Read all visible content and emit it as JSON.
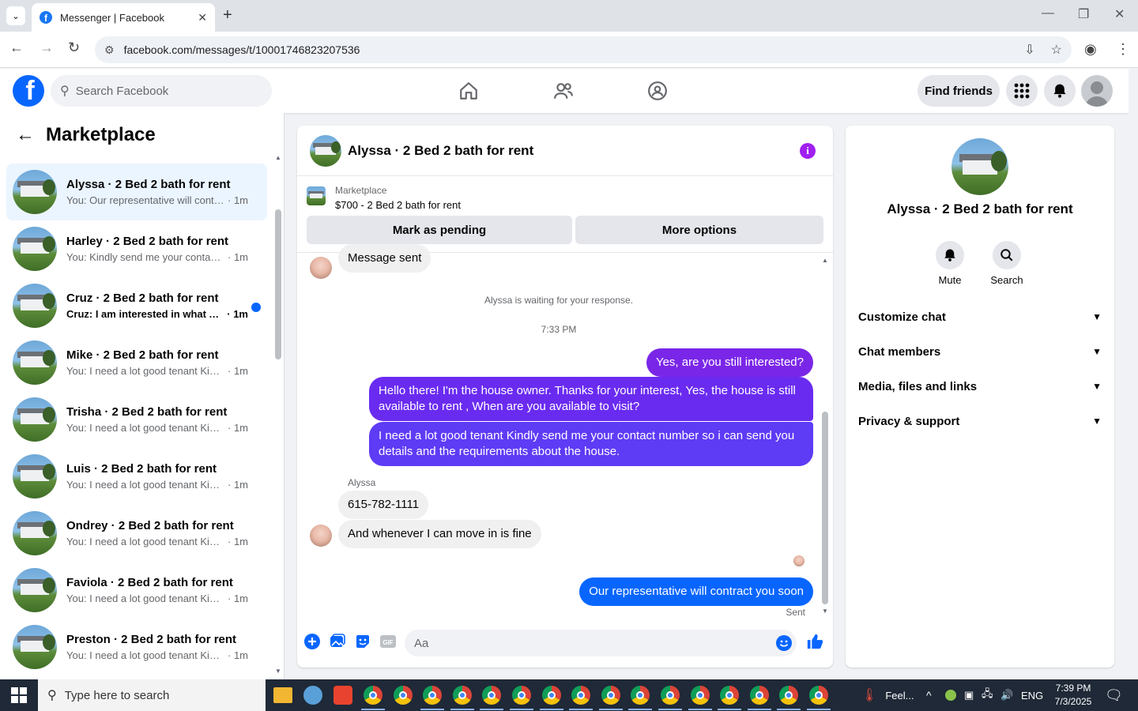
{
  "browser": {
    "tab_title": "Messenger | Facebook",
    "url": "facebook.com/messages/t/10001746823207536"
  },
  "fbnav": {
    "search_placeholder": "Search Facebook",
    "find_friends": "Find friends"
  },
  "sidebar": {
    "title": "Marketplace",
    "conversations": [
      {
        "name": "Alyssa · 2 Bed 2 bath for rent",
        "preview": "You: Our representative will contra...",
        "time": "· 1m",
        "active": true
      },
      {
        "name": "Harley · 2 Bed 2 bath for rent",
        "preview": "You: Kindly send me your contact ...",
        "time": "· 1m"
      },
      {
        "name": "Cruz · 2 Bed 2 bath for rent",
        "preview": "Cruz: I am interested in what A...",
        "time": "· 1m",
        "unread": true
      },
      {
        "name": "Mike · 2 Bed 2 bath for rent",
        "preview": "You: I need a lot good tenant Kindl...",
        "time": "· 1m"
      },
      {
        "name": "Trisha · 2 Bed 2 bath for rent",
        "preview": "You: I need a lot good tenant Kindl...",
        "time": "· 1m"
      },
      {
        "name": "Luis · 2 Bed 2 bath for rent",
        "preview": "You: I need a lot good tenant Kindl...",
        "time": "· 1m"
      },
      {
        "name": "Ondrey · 2 Bed 2 bath for rent",
        "preview": "You: I need a lot good tenant Kindl...",
        "time": "· 1m"
      },
      {
        "name": "Faviola · 2 Bed 2 bath for rent",
        "preview": "You: I need a lot good tenant Kindl...",
        "time": "· 1m"
      },
      {
        "name": "Preston · 2 Bed 2 bath for rent",
        "preview": "You: I need a lot good tenant Kindl...",
        "time": "· 1m"
      }
    ]
  },
  "chat": {
    "header_name": "Alyssa · 2 Bed 2 bath for rent",
    "listing_category": "Marketplace",
    "listing_price": "$700 - 2 Bed 2 bath for rent",
    "mark_pending": "Mark as pending",
    "more_options": "More options",
    "msg_sent": "Message sent",
    "waiting_note": "Alyssa is waiting for your response.",
    "timestamp": "7:33 PM",
    "out1": "Yes, are you still interested?",
    "out2": "Hello there! I'm the house owner. Thanks for your interest, Yes, the house is still available to rent , When are you available to visit?",
    "out3": "I need a lot good tenant Kindly send me your contact number so i can send you details and the requirements about the house.",
    "sender": "Alyssa",
    "in1": "615-782-1111",
    "in2": "And whenever I can move in is fine",
    "out4": "Our representative will contract you soon",
    "status": "Sent",
    "composer_placeholder": "Aa"
  },
  "rpanel": {
    "name": "Alyssa · 2 Bed 2 bath for rent",
    "mute": "Mute",
    "search": "Search",
    "sections": [
      "Customize chat",
      "Chat members",
      "Media, files and links",
      "Privacy & support"
    ]
  },
  "taskbar": {
    "search_placeholder": "Type here to search",
    "weather": "Feel...",
    "lang": "ENG",
    "time": "7:39 PM",
    "date": "7/3/2025"
  },
  "colors": {
    "fb_blue": "#0866ff",
    "bubble_purple": "#6f2cf0",
    "bubble_blue": "#0866ff",
    "active_row": "#ebf5ff"
  }
}
